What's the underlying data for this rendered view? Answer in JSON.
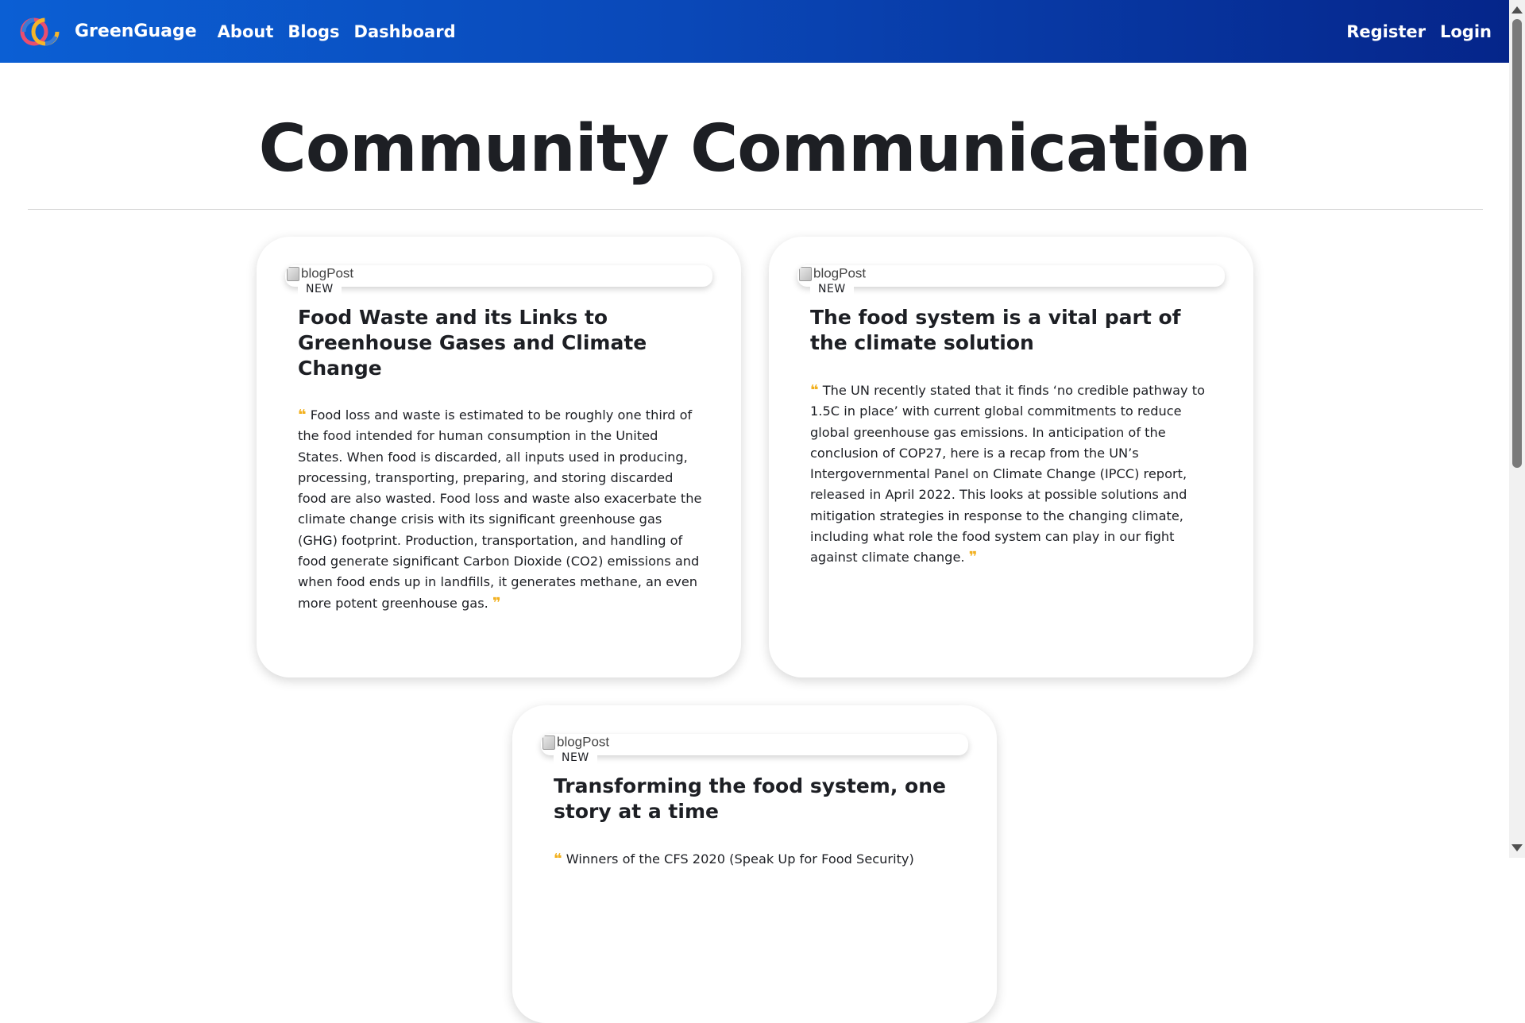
{
  "navbar": {
    "brand": "GreenGuage",
    "links": [
      "About",
      "Blogs",
      "Dashboard"
    ],
    "right_links": [
      "Register",
      "Login"
    ],
    "gradient_colors": [
      "#0b5fd4",
      "#05258a"
    ]
  },
  "page": {
    "title": "Community Communication"
  },
  "posts": [
    {
      "image_alt": "blogPost",
      "badge": "NEW",
      "title": "Food Waste and its Links to Greenhouse Gases and Climate Change",
      "excerpt": "Food loss and waste is estimated to be roughly one third of the food intended for human consumption in the United States. When food is discarded, all inputs used in producing, processing, transporting, preparing, and storing discarded food are also wasted. Food loss and waste also exacerbate the climate change crisis with its significant greenhouse gas (GHG) footprint. Production, transportation, and handling of food generate significant Carbon Dioxide (CO2) emissions and when food ends up in landfills, it generates methane, an even more potent greenhouse gas."
    },
    {
      "image_alt": "blogPost",
      "badge": "NEW",
      "title": "The food system is a vital part of the climate solution",
      "excerpt": "The UN recently stated that it finds ‘no credible pathway to 1.5C in place’ with current global commitments to reduce global greenhouse gas emissions. In anticipation of the conclusion of COP27, here is a recap from the UN’s Intergovernmental Panel on Climate Change (IPCC) report, released in April 2022. This looks at possible solutions and mitigation strategies in response to the changing climate, including what role the food system can play in our fight against climate change."
    },
    {
      "image_alt": "blogPost",
      "badge": "NEW",
      "title": "Transforming the food system, one story at a time",
      "excerpt": "Winners of the CFS 2020 (Speak Up for Food Security)"
    }
  ],
  "colors": {
    "quote_accent": "#f2b01e",
    "text": "#1d1f24"
  },
  "icons": {
    "quote_open": "❝",
    "quote_close": "❞",
    "logo": "greenguage-logo-icon",
    "broken_image": "broken-image-icon"
  }
}
